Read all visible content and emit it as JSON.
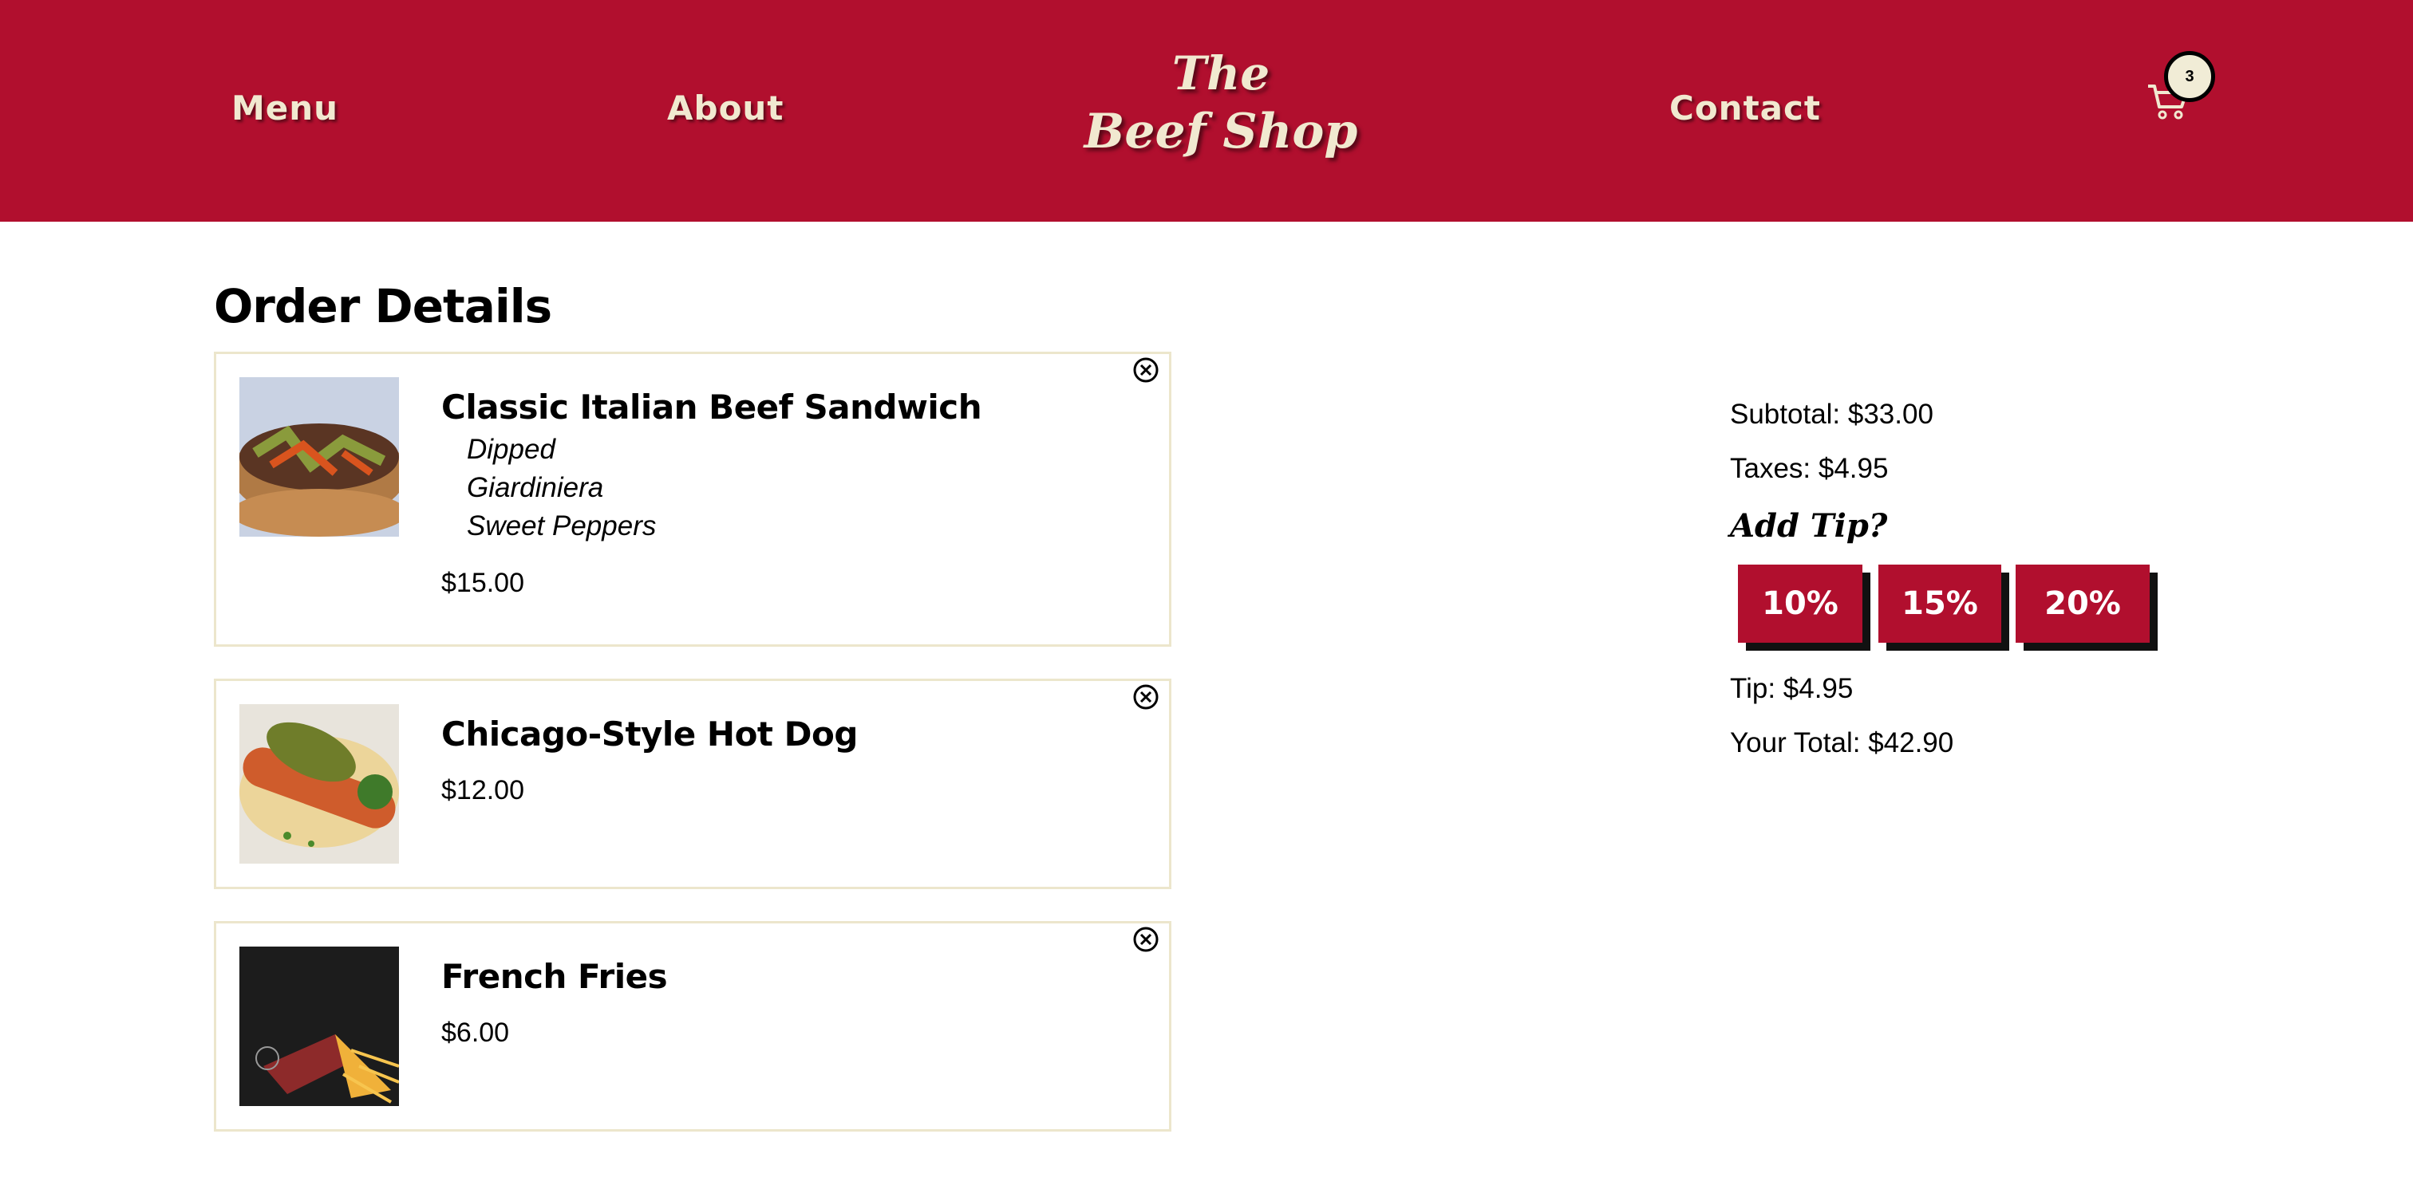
{
  "nav": {
    "menu": "Menu",
    "about": "About",
    "contact": "Contact"
  },
  "logo": {
    "line1": "The",
    "line2": "Beef Shop"
  },
  "cart": {
    "count": "3",
    "icon": "cart-icon"
  },
  "order": {
    "title": "Order Details",
    "items": [
      {
        "name": "Classic Italian Beef Sandwich",
        "modifiers": [
          "Dipped",
          "Giardiniera",
          "Sweet Peppers"
        ],
        "price": "$15.00"
      },
      {
        "name": "Chicago-Style Hot Dog",
        "modifiers": [],
        "price": "$12.00"
      },
      {
        "name": "French Fries",
        "modifiers": [],
        "price": "$6.00"
      }
    ]
  },
  "summary": {
    "subtotal": "Subtotal: $33.00",
    "taxes": "Taxes: $4.95",
    "tip_heading": "Add Tip?",
    "tip_options": [
      "10%",
      "15%",
      "20%"
    ],
    "tip": "Tip: $4.95",
    "total": "Your Total: $42.90"
  },
  "colors": {
    "brand": "#b10f2e",
    "cream": "#f1e9d0"
  }
}
